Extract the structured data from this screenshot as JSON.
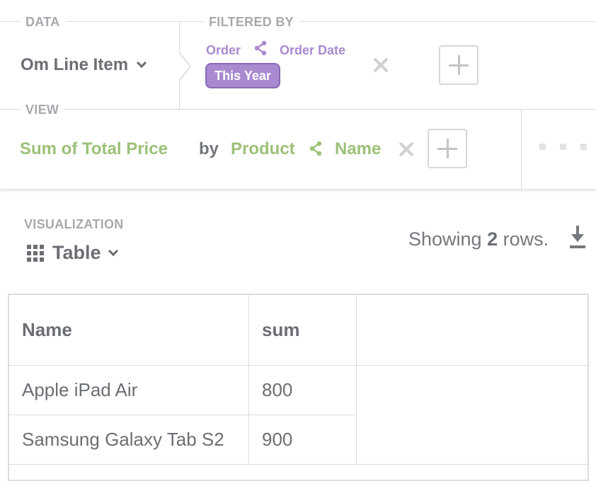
{
  "builder": {
    "data_label": "DATA",
    "filtered_by_label": "FILTERED BY",
    "view_label": "VIEW",
    "data_source": "Om Line Item",
    "filter": {
      "field_parent": "Order",
      "field_name": "Order Date",
      "value": "This Year"
    },
    "view": {
      "metric": "Sum of Total Price",
      "by_word": "by",
      "group_parent": "Product",
      "group_field": "Name"
    }
  },
  "visualization": {
    "label": "VISUALIZATION",
    "type": "Table",
    "icon": "grid-icon"
  },
  "rows_info": {
    "prefix": "Showing",
    "count": "2",
    "suffix": "rows."
  },
  "table": {
    "headers": [
      "Name",
      "sum"
    ],
    "rows": [
      [
        "Apple iPad Air",
        "800"
      ],
      [
        "Samsung Galaxy Tab S2",
        "900"
      ]
    ]
  },
  "colors": {
    "purple_accent": "#a98ad0",
    "green_accent": "#9cc177",
    "text_gray": "#6b6e73",
    "label_gray": "#a7a9ad"
  }
}
